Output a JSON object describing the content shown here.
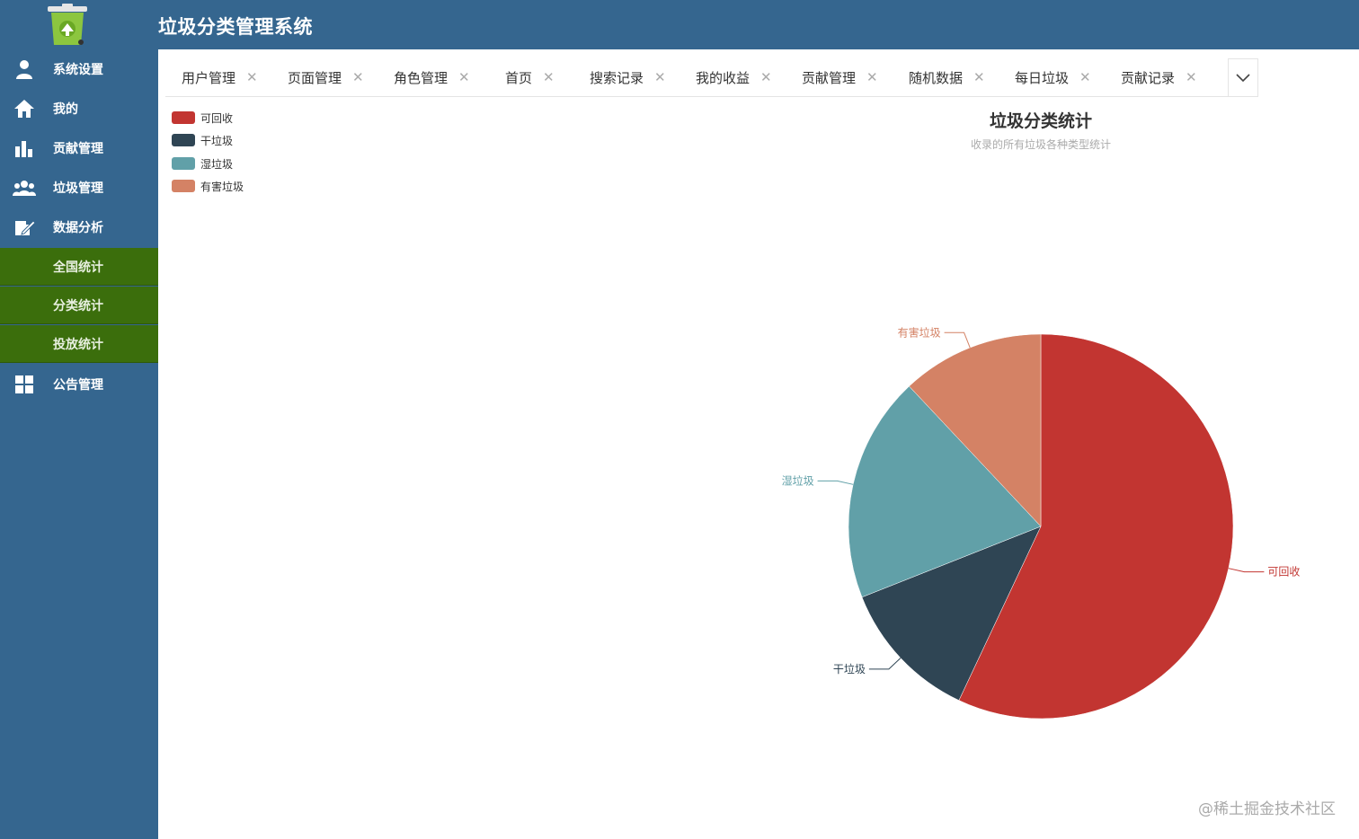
{
  "app": {
    "title": "垃圾分类管理系统"
  },
  "sidebar": {
    "items": [
      {
        "label": "系统设置",
        "icon": "user-icon"
      },
      {
        "label": "我的",
        "icon": "home-icon"
      },
      {
        "label": "贡献管理",
        "icon": "bar-chart-icon"
      },
      {
        "label": "垃圾管理",
        "icon": "group-icon"
      },
      {
        "label": "数据分析",
        "icon": "edit-icon"
      }
    ],
    "sub_items": [
      {
        "label": "全国统计"
      },
      {
        "label": "分类统计"
      },
      {
        "label": "投放统计"
      }
    ],
    "last_item": {
      "label": "公告管理",
      "icon": "grid-icon"
    }
  },
  "tabs": [
    {
      "label": "用户管理"
    },
    {
      "label": "页面管理"
    },
    {
      "label": "角色管理"
    },
    {
      "label": "首页"
    },
    {
      "label": "搜索记录"
    },
    {
      "label": "我的收益"
    },
    {
      "label": "贡献管理"
    },
    {
      "label": "随机数据"
    },
    {
      "label": "每日垃圾"
    },
    {
      "label": "贡献记录"
    }
  ],
  "chart_data": {
    "type": "pie",
    "title": "垃圾分类统计",
    "subtitle": "收录的所有垃圾各种类型统计",
    "legend_position": "top-left",
    "categories": [
      "可回收",
      "干垃圾",
      "湿垃圾",
      "有害垃圾"
    ],
    "values": [
      57,
      12,
      19,
      12
    ],
    "colors": [
      "#c23531",
      "#2f4554",
      "#61a0a8",
      "#d48265"
    ]
  },
  "watermark": "@稀土掘金技术社区"
}
